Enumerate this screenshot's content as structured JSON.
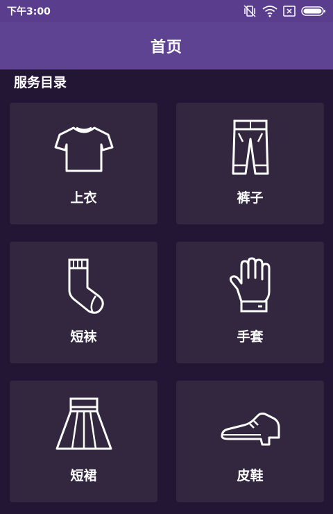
{
  "status_bar": {
    "time": "下午3:00"
  },
  "app_bar": {
    "title": "首页"
  },
  "section": {
    "title": "服务目录"
  },
  "categories": [
    {
      "label": "上衣",
      "icon": "tshirt-icon"
    },
    {
      "label": "裤子",
      "icon": "pants-icon"
    },
    {
      "label": "短袜",
      "icon": "sock-icon"
    },
    {
      "label": "手套",
      "icon": "glove-icon"
    },
    {
      "label": "短裙",
      "icon": "skirt-icon"
    },
    {
      "label": "皮鞋",
      "icon": "shoe-icon"
    }
  ],
  "colors": {
    "status_bar": "#5b3d8e",
    "app_bar": "#5f4393",
    "background": "#221634",
    "card": "#33273f",
    "icon_stroke": "#ffffff"
  }
}
